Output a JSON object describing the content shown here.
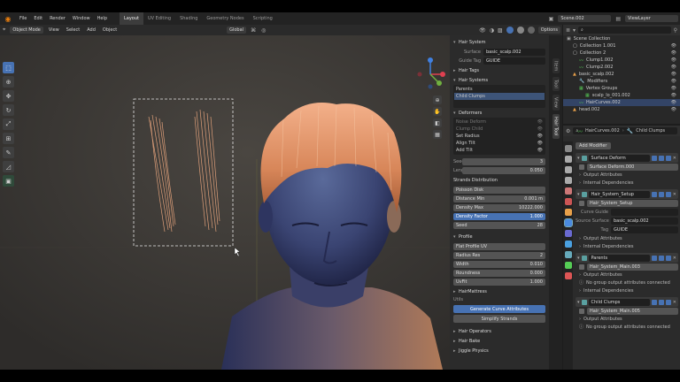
{
  "topbar": {
    "menus": [
      "File",
      "Edit",
      "Render",
      "Window",
      "Help"
    ],
    "workspaces": [
      "Layout",
      "UV Editing",
      "Shading",
      "Geometry Nodes",
      "Scripting"
    ],
    "active_workspace": "Layout",
    "scene": "Scene.002",
    "view_layer": "ViewLayer"
  },
  "viewport_header": {
    "mode": "Object Mode",
    "menus": [
      "View",
      "Select",
      "Add",
      "Object"
    ],
    "transform": "Global",
    "options": "Options"
  },
  "npanel": {
    "hair_system": {
      "title": "Hair System",
      "surface_label": "Surface",
      "surface_value": "basic_scalp.002",
      "guide_tag_label": "Guide Tag",
      "guide_tag_value": "GUIDE"
    },
    "hair_tags": "Hair Tags",
    "hair_systems": {
      "title": "Hair Systems",
      "items": [
        "Parents",
        "Child Clumps"
      ]
    },
    "deformers": {
      "title": "Deformers",
      "items": [
        {
          "label": "Noise Deform",
          "dim": true
        },
        {
          "label": "Clump Child",
          "dim": true
        },
        {
          "label": "Set Radius",
          "dim": false
        },
        {
          "label": "Align Tilt",
          "dim": false
        },
        {
          "label": "Add Tilt",
          "dim": false
        }
      ]
    },
    "seed": {
      "label": "Seed",
      "value": "3"
    },
    "length": {
      "label": "Length",
      "value": "0.050"
    },
    "strands": {
      "title": "Strands Distribution",
      "method": "Poisson Disk",
      "distance_min": {
        "label": "Distance Min",
        "value": "0.001 m"
      },
      "density_max": {
        "label": "Density Max",
        "value": "10222.000"
      },
      "density_factor": {
        "label": "Density Factor",
        "value": "1.000"
      },
      "seed": {
        "label": "Seed",
        "value": "28"
      }
    },
    "profile": {
      "title": "Profile",
      "preset": "Flat Profile UV",
      "radius_res": {
        "label": "Radius Res",
        "value": "2"
      },
      "width": {
        "label": "Width",
        "value": "0.010"
      },
      "roundness": {
        "label": "Roundness",
        "value": "0.000"
      },
      "uvfit": {
        "label": "UvFit",
        "value": "1.000"
      }
    },
    "hair_mattress": "HairMattress",
    "utils": "Utils",
    "generate_btn": "Generate Curve Attributes",
    "simplify_btn": "Simplify Strands",
    "hair_operators": "Hair Operators",
    "hair_bake": "Hair Bake",
    "jiggle_physics": "Jiggle Physics"
  },
  "vtabs": [
    "Item",
    "Tool",
    "View",
    "Hair Tool"
  ],
  "outliner": {
    "search_placeholder": "",
    "rows": [
      {
        "label": "Scene Collection",
        "indent": 0
      },
      {
        "label": "Collection 1.001",
        "indent": 1
      },
      {
        "label": "Collection 2",
        "indent": 1
      },
      {
        "label": "Clump1.002",
        "indent": 2
      },
      {
        "label": "Clump2.002",
        "indent": 2
      },
      {
        "label": "basic_scalp.002",
        "indent": 1
      },
      {
        "label": "Modifiers",
        "indent": 2
      },
      {
        "label": "Vertex Groups",
        "indent": 2
      },
      {
        "label": "scalp_lo_001.002",
        "indent": 3
      },
      {
        "label": "HairCurves.002",
        "indent": 2
      },
      {
        "label": "head.002",
        "indent": 1
      }
    ]
  },
  "properties": {
    "object": "HairCurves.002",
    "system": "Child Clumps",
    "add_modifier": "Add Modifier",
    "modifiers": [
      {
        "name": "Surface Deform",
        "sub": "Surface Deform.000",
        "sections": [
          "Output Attributes",
          "Internal Dependencies"
        ]
      },
      {
        "name": "Hair_System_Setup",
        "sub": "Hair_System_Setup",
        "fields": [
          {
            "label": "Curve Guide",
            "value": ""
          },
          {
            "label": "Source Surface",
            "value": "basic_scalp.002"
          },
          {
            "label": "Tag",
            "value": "GUIDE"
          }
        ],
        "sections": [
          "Output Attributes",
          "Internal Dependencies"
        ]
      },
      {
        "name": "Parents",
        "sub": "Hair_System_Main.003",
        "sections": [
          "Output Attributes",
          "No group output attributes connected",
          "Internal Dependencies"
        ]
      },
      {
        "name": "Child Clumps",
        "sub": "Hair_System_Main.005",
        "sections": [
          "Output Attributes",
          "No group output attributes connected"
        ]
      }
    ],
    "no_output_note": "No group output attributes connected"
  }
}
